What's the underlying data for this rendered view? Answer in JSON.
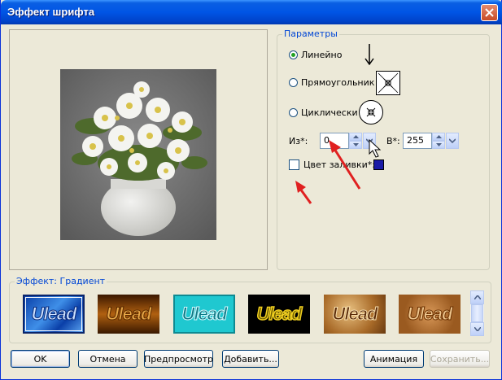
{
  "window": {
    "title": "Эффект шрифта"
  },
  "params": {
    "legend": "Параметры",
    "radio_linear": "Линейно",
    "radio_rect": "Прямоугольник",
    "radio_cyclic": "Циклически",
    "from_label": "Из*:",
    "from_value": "0",
    "to_label": "В*:",
    "to_value": "255",
    "fill_color_label": "Цвет заливки*:",
    "fill_color": "#1A1AA6"
  },
  "effect": {
    "legend": "Эффект: Градиент",
    "thumbs": [
      {
        "text": "Ulead",
        "selected": true
      },
      {
        "text": "Ulead",
        "selected": false
      },
      {
        "text": "Ulead",
        "selected": false
      },
      {
        "text": "Ulead",
        "selected": false
      },
      {
        "text": "Ulead",
        "selected": false
      },
      {
        "text": "Ulead",
        "selected": false
      }
    ]
  },
  "buttons": {
    "ok": "OK",
    "cancel": "Отмена",
    "preview": "Предпросмотр",
    "add": "Добавить...",
    "animation": "Анимация",
    "save": "Сохранить..."
  },
  "colors": {
    "title_bar": "#0055E5",
    "dialog_bg": "#ECE9D8",
    "legend_text": "#0046D5",
    "annotation_arrow": "#E02020"
  }
}
